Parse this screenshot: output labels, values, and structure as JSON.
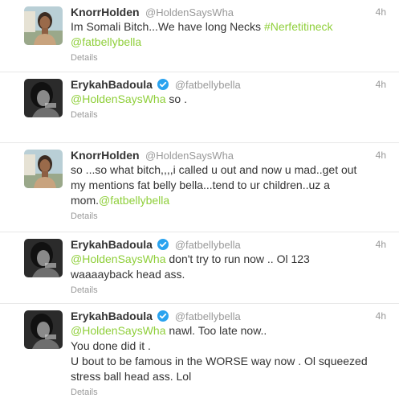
{
  "colors": {
    "link": "#8fcf3a",
    "muted": "#999999",
    "text": "#333333",
    "verified": "#2aa3ef"
  },
  "tweets": [
    {
      "fullname": "KnorrHolden",
      "username": "@HoldenSaysWha",
      "time": "4h",
      "verified": false,
      "avatar": "woman-portrait-avatar",
      "lines": [
        [
          {
            "t": "Im Somali Bitch...We have long Necks "
          },
          {
            "t": "#Nerfetitineck",
            "link": true
          }
        ],
        [
          {
            "t": "@fatbellybella",
            "link": true
          }
        ]
      ],
      "details": "Details"
    },
    {
      "fullname": "ErykahBadoula",
      "username": "@fatbellybella",
      "time": "4h",
      "verified": true,
      "avatar": "bw-portrait-avatar",
      "lines": [
        [
          {
            "t": "@HoldenSaysWha",
            "link": true
          },
          {
            "t": " so ."
          }
        ]
      ],
      "details": "Details"
    },
    {
      "fullname": "KnorrHolden",
      "username": "@HoldenSaysWha",
      "time": "4h",
      "verified": false,
      "avatar": "woman-portrait-avatar",
      "lines": [
        [
          {
            "t": "so ...so what bitch,,,,i called u out and now u mad..get out"
          }
        ],
        [
          {
            "t": "my mentions fat belly bella...tend to ur children..uz a"
          }
        ],
        [
          {
            "t": "mom."
          },
          {
            "t": "@fatbellybella",
            "link": true
          }
        ]
      ],
      "details": "Details"
    },
    {
      "fullname": "ErykahBadoula",
      "username": "@fatbellybella",
      "time": "4h",
      "verified": true,
      "avatar": "bw-portrait-avatar",
      "lines": [
        [
          {
            "t": "@HoldenSaysWha",
            "link": true
          },
          {
            "t": " don't try to run now .. Ol 123"
          }
        ],
        [
          {
            "t": "waaaayback head ass."
          }
        ]
      ],
      "details": "Details"
    },
    {
      "fullname": "ErykahBadoula",
      "username": "@fatbellybella",
      "time": "4h",
      "verified": true,
      "avatar": "bw-portrait-avatar",
      "lines": [
        [
          {
            "t": "@HoldenSaysWha",
            "link": true
          },
          {
            "t": " nawl. Too late now.."
          }
        ],
        [
          {
            "t": "You done did it ."
          }
        ],
        [
          {
            "t": "U bout to be famous in the WORSE way now . Ol squeezed"
          }
        ],
        [
          {
            "t": "stress ball head ass. Lol"
          }
        ]
      ],
      "details": "Details"
    }
  ]
}
